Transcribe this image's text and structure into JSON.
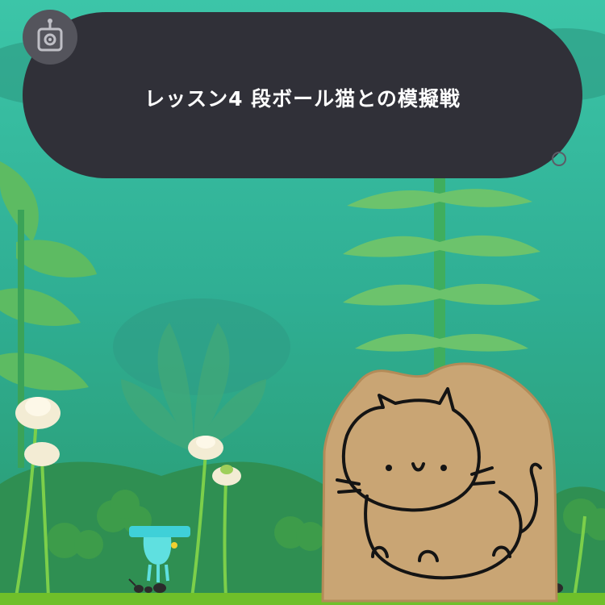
{
  "dialog": {
    "text": "レッスン4 段ボール猫との模擬戦",
    "speaker_icon": "robot-head-icon",
    "advance_icon": "circle-indicator-icon"
  },
  "scene": {
    "background": "forest",
    "opponent": "cardboard-cat-cutout",
    "player": "cyan-jellyfish-creature",
    "enemies": [
      "ant",
      "ant"
    ],
    "flowers": "white-clover-blossoms"
  },
  "colors": {
    "dialog_bg": "#303038",
    "badge_bg": "#54545c",
    "sky": "#34b79a",
    "ground": "#6fbf2a",
    "cardboard": "#c9a574"
  }
}
